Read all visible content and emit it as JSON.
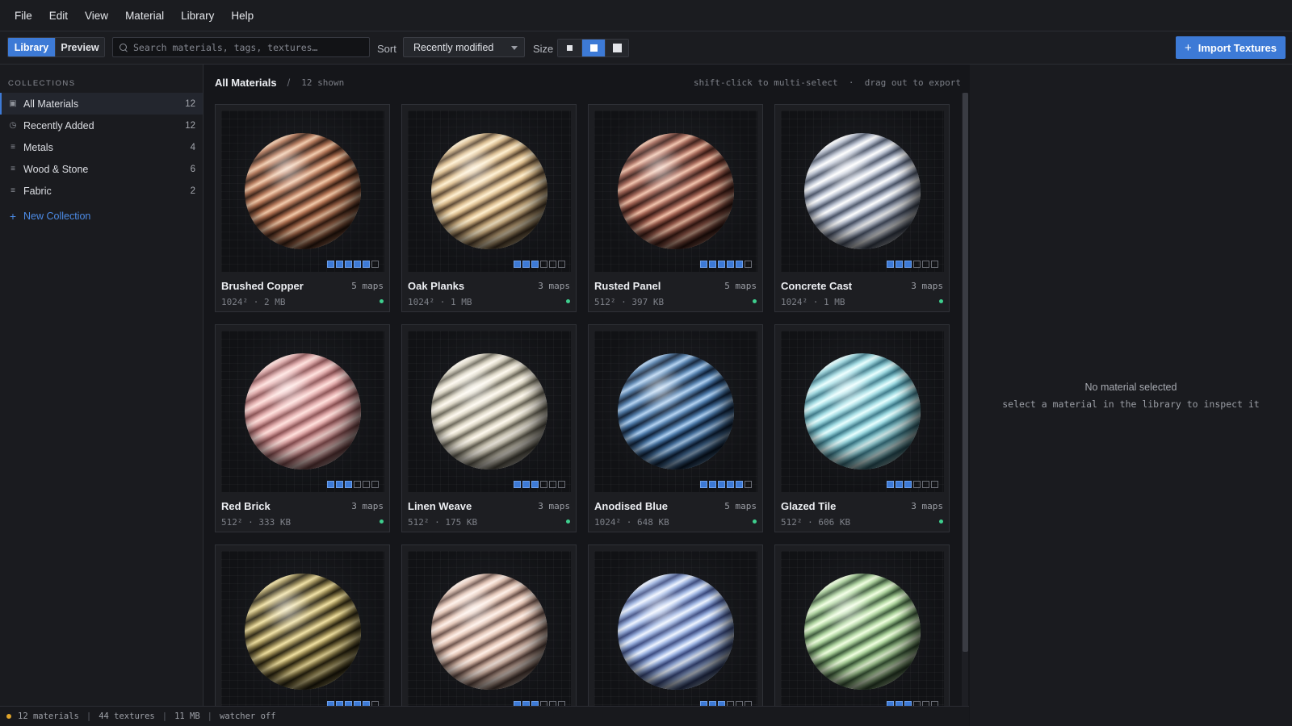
{
  "menu": [
    "File",
    "Edit",
    "View",
    "Material",
    "Library",
    "Help"
  ],
  "toolbar": {
    "tabs": [
      {
        "label": "Library",
        "active": true
      },
      {
        "label": "Preview",
        "active": false
      }
    ],
    "search_placeholder": "Search materials, tags, textures…",
    "sort_label": "Sort",
    "sort_value": "Recently modified",
    "size_label": "Size",
    "size_selected": "medium",
    "import_label": "Import Textures"
  },
  "sidebar": {
    "heading": "COLLECTIONS",
    "items": [
      {
        "label": "All Materials",
        "count": "12",
        "icon": "grid-icon",
        "active": true
      },
      {
        "label": "Recently Added",
        "count": "12",
        "icon": "clock-icon",
        "active": false
      },
      {
        "label": "Metals",
        "count": "4",
        "icon": "list-icon",
        "active": false
      },
      {
        "label": "Wood & Stone",
        "count": "6",
        "icon": "list-icon",
        "active": false
      },
      {
        "label": "Fabric",
        "count": "2",
        "icon": "list-icon",
        "active": false
      }
    ],
    "new_collection": "New Collection"
  },
  "main": {
    "title": "All Materials",
    "separator": "/",
    "count": "12 shown",
    "hint": "shift-click to multi-select  ·  drag out to export"
  },
  "materials": [
    {
      "name": "Brushed Copper",
      "maps": "5 maps",
      "maps_on": 5,
      "meta": "1024² · 2 MB",
      "colors": [
        "#3a2014",
        "#b07050",
        "#f0c8a8"
      ]
    },
    {
      "name": "Oak Planks",
      "maps": "3 maps",
      "maps_on": 3,
      "meta": "1024² · 1 MB",
      "colors": [
        "#5a4630",
        "#d8b888",
        "#fff0d0"
      ]
    },
    {
      "name": "Rusted Panel",
      "maps": "5 maps",
      "maps_on": 5,
      "meta": "512² · 397 KB",
      "colors": [
        "#3a1a14",
        "#a06050",
        "#f0c0a8"
      ]
    },
    {
      "name": "Concrete Cast",
      "maps": "3 maps",
      "maps_on": 3,
      "meta": "1024² · 1 MB",
      "colors": [
        "#4a5468",
        "#b8c0d0",
        "#ffffff"
      ]
    },
    {
      "name": "Red Brick",
      "maps": "3 maps",
      "maps_on": 3,
      "meta": "512² · 333 KB",
      "colors": [
        "#8a5052",
        "#e0a8a8",
        "#ffe0dc"
      ]
    },
    {
      "name": "Linen Weave",
      "maps": "3 maps",
      "maps_on": 3,
      "meta": "512² · 175 KB",
      "colors": [
        "#6a6658",
        "#d8d2c0",
        "#fffaf0"
      ]
    },
    {
      "name": "Anodised Blue",
      "maps": "5 maps",
      "maps_on": 5,
      "meta": "1024² · 648 KB",
      "colors": [
        "#0e2038",
        "#4a78a8",
        "#b0d0f0"
      ]
    },
    {
      "name": "Glazed Tile",
      "maps": "3 maps",
      "maps_on": 3,
      "meta": "512² · 606 KB",
      "colors": [
        "#3a7888",
        "#9ad8e0",
        "#e8ffff"
      ]
    },
    {
      "name": "",
      "maps": "",
      "maps_on": 5,
      "meta": "",
      "colors": [
        "#2a2410",
        "#988850",
        "#f0e0a0"
      ]
    },
    {
      "name": "",
      "maps": "",
      "maps_on": 3,
      "meta": "",
      "colors": [
        "#6a5048",
        "#e0c0b0",
        "#fff0e8"
      ]
    },
    {
      "name": "",
      "maps": "",
      "maps_on": 3,
      "meta": "",
      "colors": [
        "#3a4a80",
        "#98b0e0",
        "#eef4ff"
      ]
    },
    {
      "name": "",
      "maps": "",
      "maps_on": 3,
      "meta": "",
      "colors": [
        "#3a5838",
        "#a8d098",
        "#f0ffe0"
      ]
    }
  ],
  "inspector": {
    "title": "No material selected",
    "subtitle": "select a material in the library to inspect it"
  },
  "statusbar": {
    "materials": "12 materials",
    "textures": "44 textures",
    "size": "11 MB",
    "watcher": "watcher off"
  }
}
